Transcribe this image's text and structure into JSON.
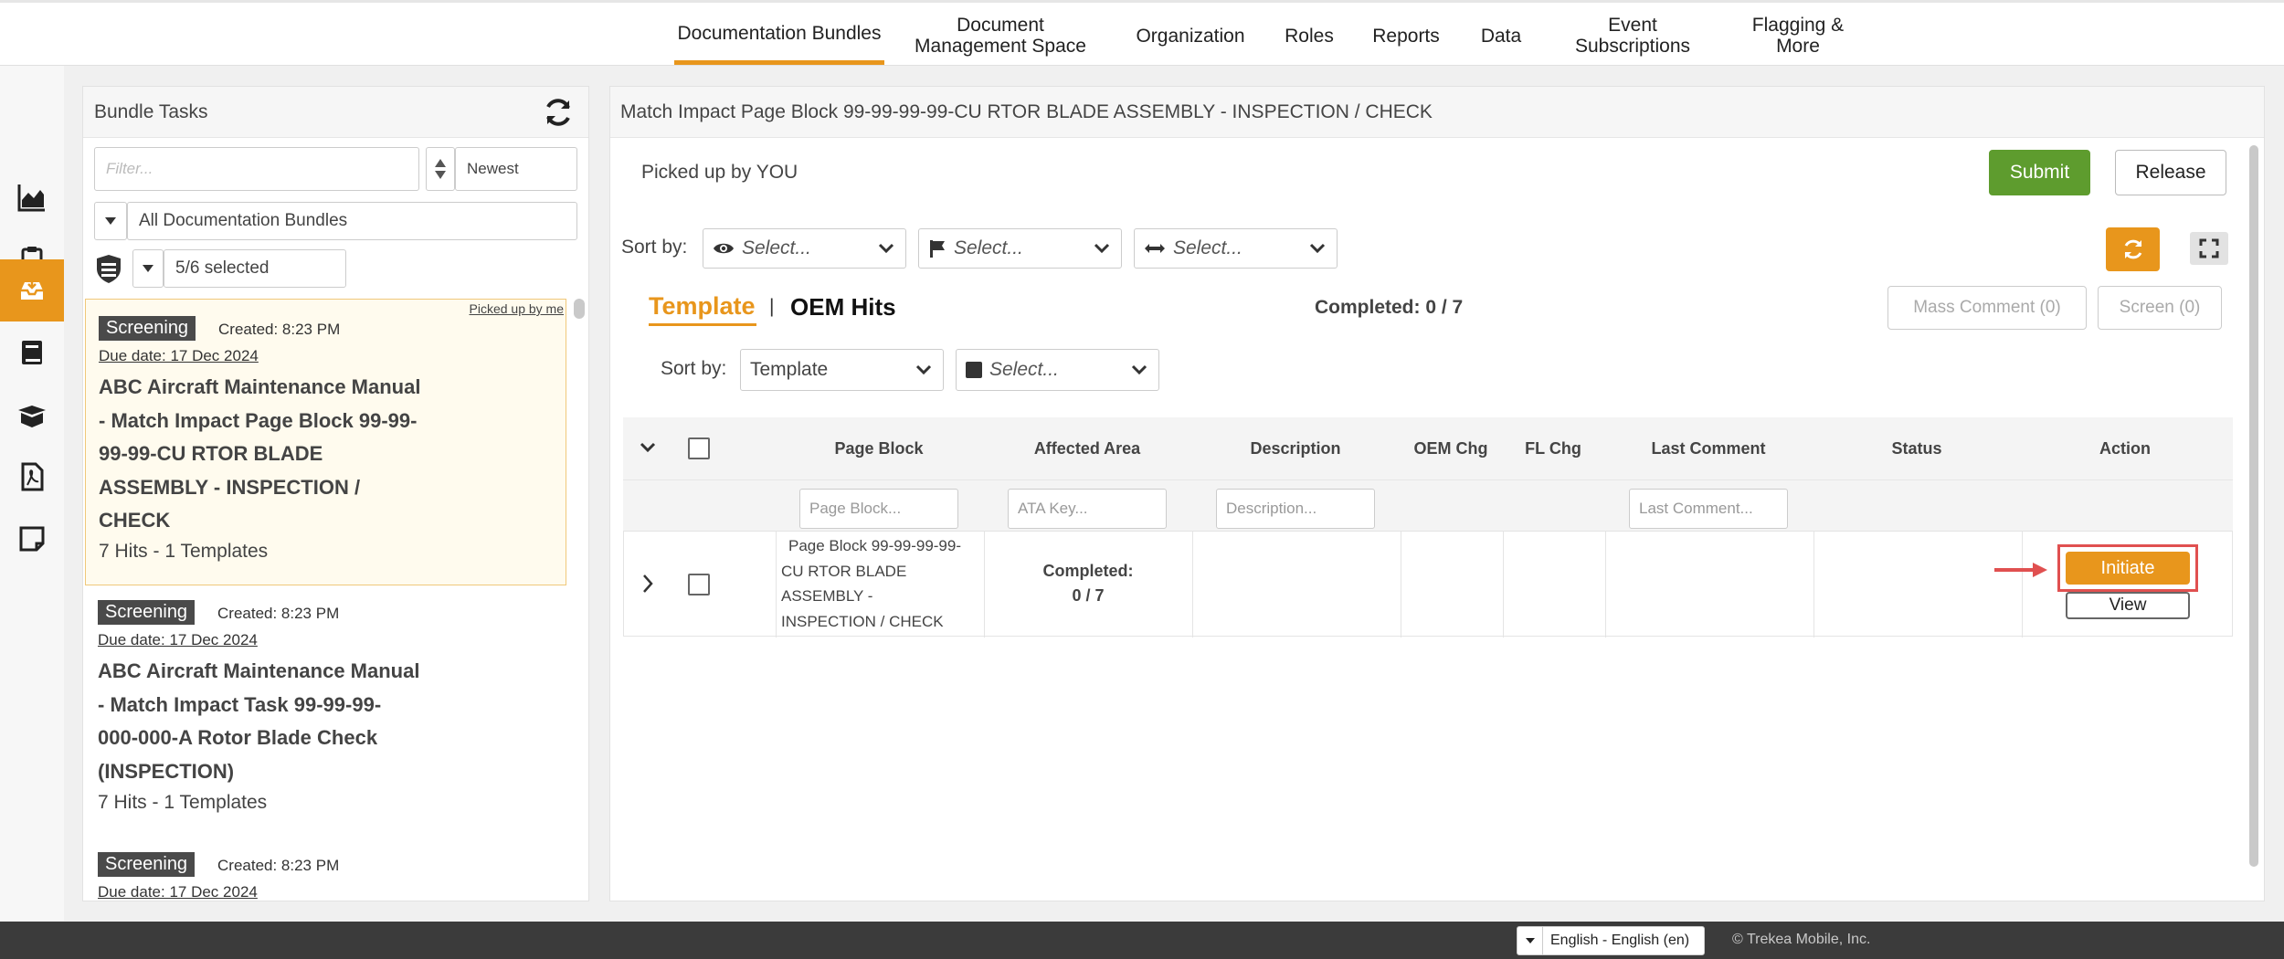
{
  "nav": {
    "items": [
      {
        "label": "Documentation Bundles",
        "active": true
      },
      {
        "label": "Document Management Space"
      },
      {
        "label": "Organization"
      },
      {
        "label": "Roles"
      },
      {
        "label": "Reports"
      },
      {
        "label": "Data"
      },
      {
        "label": "Event Subscriptions"
      },
      {
        "label": "Flagging & More"
      }
    ]
  },
  "rail": {
    "icons": [
      "chart-icon",
      "clipboard-icon",
      "inbox-icon",
      "book-icon",
      "box-icon",
      "pdf-icon",
      "note-icon"
    ],
    "active": "inbox-icon"
  },
  "left": {
    "title": "Bundle Tasks",
    "filter_placeholder": "Filter...",
    "sort_value": "Newest",
    "bundle_select": "All Documentation Bundles",
    "status_select": "5/6 selected",
    "tasks": [
      {
        "badge": "Screening",
        "created": "Created: 8:23 PM",
        "due": "Due date: 17 Dec 2024",
        "picked": "Picked up by me",
        "title_lines": [
          "ABC Aircraft Maintenance Manual",
          "- Match Impact Page Block 99-99-",
          "99-99-CU RTOR BLADE",
          "ASSEMBLY - INSPECTION /",
          "CHECK"
        ],
        "hits": "7 Hits - 1 Templates"
      },
      {
        "badge": "Screening",
        "created": "Created: 8:23 PM",
        "due": "Due date: 17 Dec 2024",
        "title_lines": [
          "ABC Aircraft Maintenance Manual",
          "- Match Impact Task 99-99-99-",
          "000-000-A Rotor Blade Check",
          "(INSPECTION)"
        ],
        "hits": "7 Hits - 1 Templates"
      },
      {
        "badge": "Screening",
        "created": "Created: 8:23 PM",
        "due": "Due date: 17 Dec 2024"
      }
    ]
  },
  "main": {
    "title": "Match Impact Page Block 99-99-99-99-CU RTOR BLADE ASSEMBLY - INSPECTION / CHECK",
    "picked_up": "Picked up by YOU",
    "submit_label": "Submit",
    "release_label": "Release",
    "sort_label": "Sort by:",
    "sort_selects": [
      "Select...",
      "Select...",
      "Select..."
    ],
    "tab_template": "Template",
    "tab_divider": "|",
    "tab_oem": "OEM Hits",
    "completed_label": "Completed:",
    "completed_value": "0 / 7",
    "mass_comment": "Mass Comment (0)",
    "screen": "Screen (0)",
    "sort2_label": "Sort by:",
    "sort2_value": "Template",
    "sort2_select": "Select...",
    "columns": [
      "Page Block",
      "Affected Area",
      "Description",
      "OEM Chg",
      "FL Chg",
      "Last Comment",
      "Status",
      "Action"
    ],
    "filters": {
      "page_block": "Page Block...",
      "ata_key": "ATA Key...",
      "description": "Description...",
      "last_comment": "Last Comment..."
    },
    "row": {
      "page_block_lines": [
        "Page Block 99-99-99-99-",
        "CU RTOR BLADE",
        "ASSEMBLY -",
        "INSPECTION / CHECK"
      ],
      "affected_label": "Completed:",
      "affected_value": "0 / 7",
      "initiate_label": "Initiate",
      "view_label": "View"
    }
  },
  "footer": {
    "language": "English - English (en)",
    "copyright": "© Trekea Mobile, Inc."
  },
  "colors": {
    "accent": "#e8961c",
    "submit": "#5e9c2e",
    "highlight": "#e05050"
  }
}
